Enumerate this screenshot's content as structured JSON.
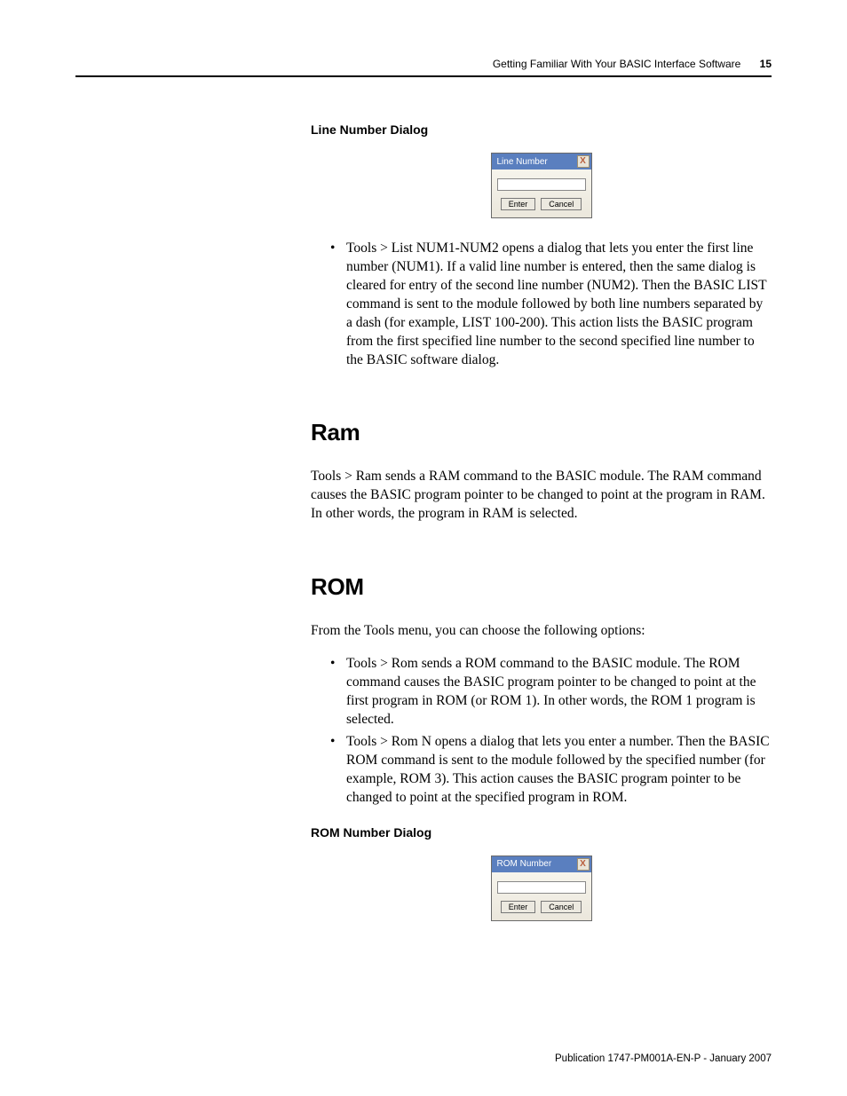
{
  "header": {
    "text": "Getting Familiar With Your BASIC Interface Software",
    "page": "15"
  },
  "headings": {
    "lineNumberDialog": "Line Number Dialog",
    "ram": "Ram",
    "rom": "ROM",
    "romNumberDialog": "ROM Number Dialog"
  },
  "dialog1": {
    "title": "Line Number",
    "close": "X",
    "enter": "Enter",
    "cancel": "Cancel"
  },
  "dialog2": {
    "title": "ROM Number",
    "close": "X",
    "enter": "Enter",
    "cancel": "Cancel"
  },
  "bullets": {
    "b1": "Tools > List NUM1-NUM2 opens a dialog that lets you enter the first line number (NUM1). If a valid line number is entered, then the same dialog is cleared for entry of the second line number (NUM2). Then the BASIC LIST command is sent to the module followed by both line numbers separated by a dash (for example, LIST 100-200). This action lists the BASIC program from the first specified line number to the second specified line number to the BASIC software dialog.",
    "b2": "Tools > Rom sends a ROM command to the BASIC module. The ROM command causes the BASIC program pointer to be changed to point at the first program in ROM (or ROM 1). In other words, the ROM 1 program is selected.",
    "b3": "Tools > Rom N opens a dialog that lets you enter a number. Then the BASIC ROM command is sent to the module followed by the specified number (for example, ROM 3). This action causes the BASIC program pointer to be changed to point at the specified program in ROM."
  },
  "paras": {
    "ram": "Tools > Ram sends a RAM command to the BASIC module. The RAM command causes the BASIC program pointer to be changed to point at the program in RAM. In other words, the program in RAM is selected.",
    "rom": "From the Tools menu, you can choose the following options:"
  },
  "footer": {
    "pub": "Publication 1747-PM001A-EN-P - January 2007"
  }
}
